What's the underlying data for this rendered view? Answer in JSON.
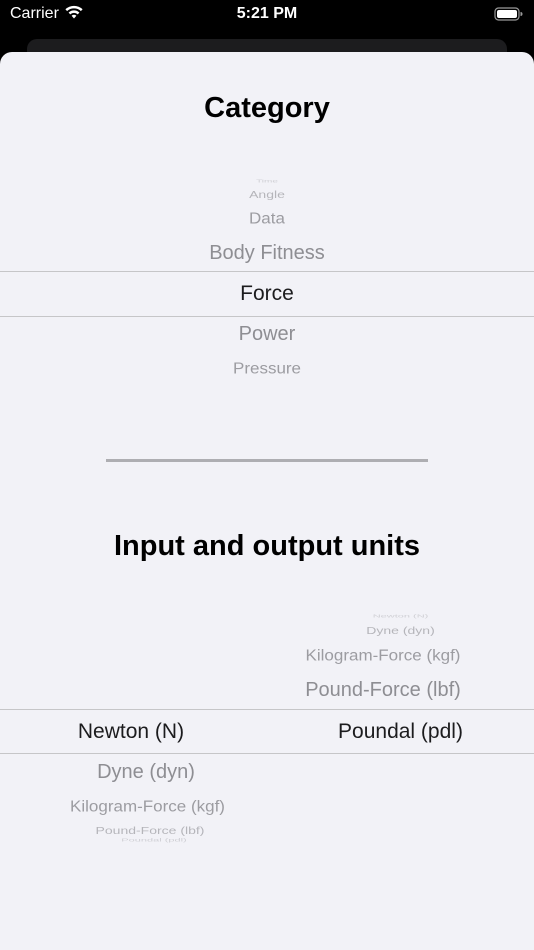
{
  "status_bar": {
    "carrier": "Carrier",
    "time": "5:21 PM",
    "icons": [
      "wifi-icon",
      "battery-icon"
    ]
  },
  "category": {
    "title": "Category",
    "items_above": [
      "Time",
      "Angle",
      "Data",
      "Body Fitness"
    ],
    "selected": "Force",
    "items_below": [
      "Power",
      "Pressure"
    ]
  },
  "units": {
    "title": "Input and output units",
    "input": {
      "selected": "Newton (N)",
      "items_below": [
        "Dyne (dyn)",
        "Kilogram-Force (kgf)",
        "Pound-Force (lbf)",
        "Poundal (pdl)"
      ]
    },
    "output": {
      "items_above": [
        "Newton (N)",
        "Dyne (dyn)",
        "Kilogram-Force (kgf)",
        "Pound-Force (lbf)"
      ],
      "selected": "Poundal (pdl)"
    }
  },
  "colors": {
    "sheet_background": "#f2f2f7",
    "selected_text": "#1c1c1e",
    "unselected_text": "#8e8e93",
    "separator": "#aeaeb2"
  }
}
